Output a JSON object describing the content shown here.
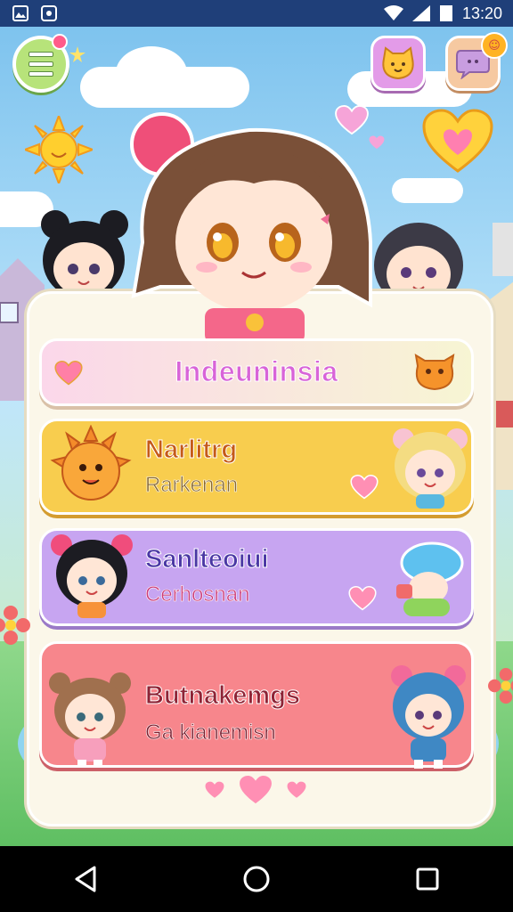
{
  "status_bar": {
    "time": "13:20"
  },
  "game": {
    "menu_label": "",
    "notification_badge": "☺",
    "cards": [
      {
        "title": "Indeuninsia",
        "subtitle": ""
      },
      {
        "title": "Narlitrg",
        "subtitle": "Rarkenan"
      },
      {
        "title": "Sanlteoiui",
        "subtitle": "Cerhosnan"
      },
      {
        "title": "Butnakemgs",
        "subtitle": "Ga kianemisn"
      }
    ]
  },
  "colors": {
    "status_bar": "#1f3f79",
    "card_1": "#f7f5d3",
    "card_2": "#f8cd4e",
    "card_3": "#c7a5f1",
    "card_4": "#f7868c",
    "heart": "#ff7fa6"
  },
  "icons": [
    "menu-icon",
    "cat-icon",
    "chat-icon",
    "heart-icon",
    "sun-icon",
    "back-icon",
    "home-icon",
    "recents-icon"
  ]
}
